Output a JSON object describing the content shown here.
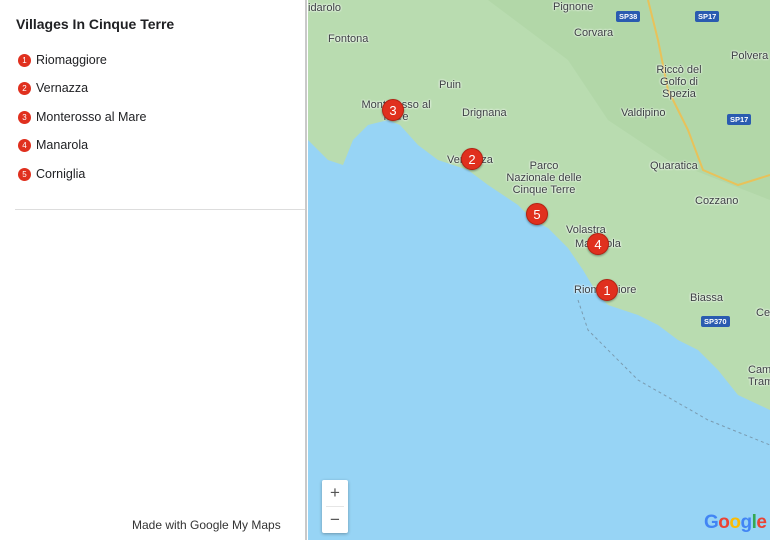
{
  "panel": {
    "title": "Villages In Cinque Terre",
    "items": [
      {
        "num": "1",
        "label": "Riomaggiore"
      },
      {
        "num": "2",
        "label": "Vernazza"
      },
      {
        "num": "3",
        "label": "Monterosso al Mare"
      },
      {
        "num": "4",
        "label": "Manarola"
      },
      {
        "num": "5",
        "label": "Corniglia"
      }
    ],
    "credit": "Made with Google My Maps"
  },
  "map": {
    "places": [
      "idarolo",
      "Fontona",
      "Pignone",
      "Corvara",
      "Polvera",
      "Riccò del Golfo di Spezia",
      "Puin",
      "Drignana",
      "Valdipino",
      "Quaratica",
      "Parco Nazionale delle Cinque Terre",
      "Cozzano",
      "Volastra",
      "Biassa",
      "Campiglia Tramonti",
      "Cep",
      "Monterosso al Mare",
      "Vernazza",
      "Manarola",
      "Riomaggiore"
    ],
    "roads": [
      "SP38",
      "SP17",
      "SP17",
      "SP370"
    ],
    "markers": [
      "1",
      "2",
      "3",
      "4",
      "5"
    ],
    "zoom_in": "+",
    "zoom_out": "−",
    "logo": "Google",
    "colors": {
      "sea": "#97d4f5",
      "land": "#b9dcb0",
      "marker": "#e0301e"
    }
  }
}
